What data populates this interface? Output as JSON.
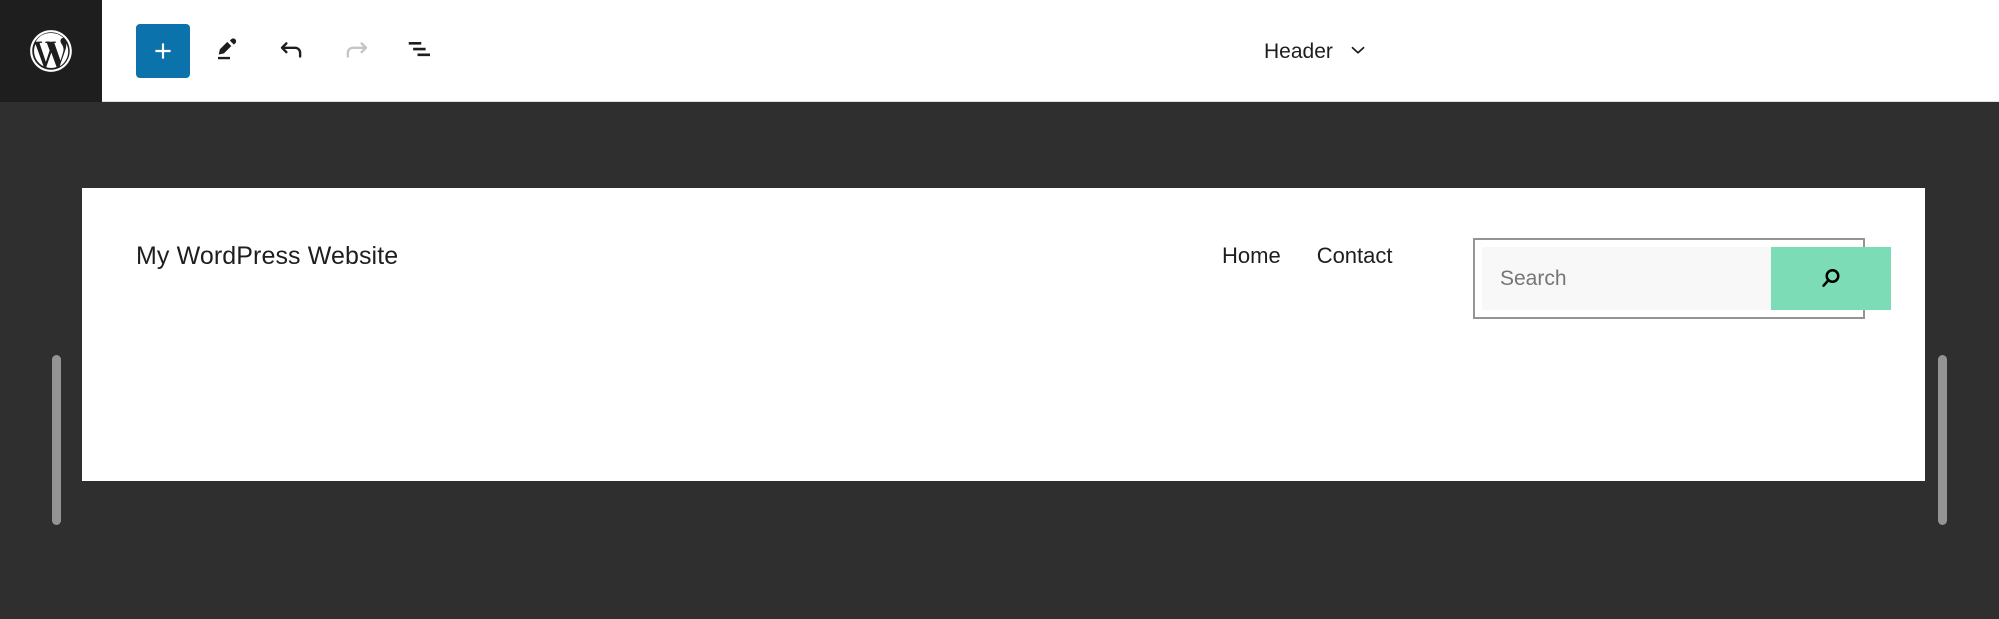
{
  "toolbar": {
    "logo": {
      "name": "wordpress-logo",
      "label": "WordPress"
    },
    "buttons": [
      {
        "name": "add-block-button",
        "label": "Toggle block inserter",
        "icon": "plus-icon",
        "state": "active"
      },
      {
        "name": "edit-mode-button",
        "label": "Edit",
        "icon": "pencil-icon",
        "state": "enabled"
      },
      {
        "name": "undo-button",
        "label": "Undo",
        "icon": "undo-arrow-icon",
        "state": "enabled"
      },
      {
        "name": "redo-button",
        "label": "Redo",
        "icon": "redo-arrow-icon",
        "state": "disabled"
      },
      {
        "name": "list-view-button",
        "label": "Document Overview",
        "icon": "list-view-icon",
        "state": "enabled"
      }
    ],
    "document": {
      "title": "Header",
      "dropdown_icon": "chevron-down-icon"
    }
  },
  "canvas": {
    "resize_handles": [
      {
        "name": "resize-handle-left",
        "label": "Drag to resize"
      },
      {
        "name": "resize-handle-right",
        "label": "Drag to resize"
      }
    ],
    "header_block": {
      "site_title": "My WordPress Website",
      "navigation": [
        {
          "label": "Home"
        },
        {
          "label": "Contact"
        }
      ],
      "search": {
        "placeholder": "Search",
        "value": "",
        "button_icon": "search-magnifier-icon",
        "button_label": "Search"
      }
    }
  },
  "colors": {
    "toolbar_background": "#ffffff",
    "logo_background": "#1e1e1e",
    "editor_background": "#2f2f2f",
    "canvas_background": "#ffffff",
    "add_block_accent": "#0b72ab",
    "search_button": "#7bdcb5",
    "search_border": "#949494",
    "search_input_fill": "#f8f8f8",
    "placeholder_text": "#767676",
    "text_primary": "#1e1e1e",
    "icon_disabled": "#c5c5c5",
    "resize_handle": "#949494"
  }
}
